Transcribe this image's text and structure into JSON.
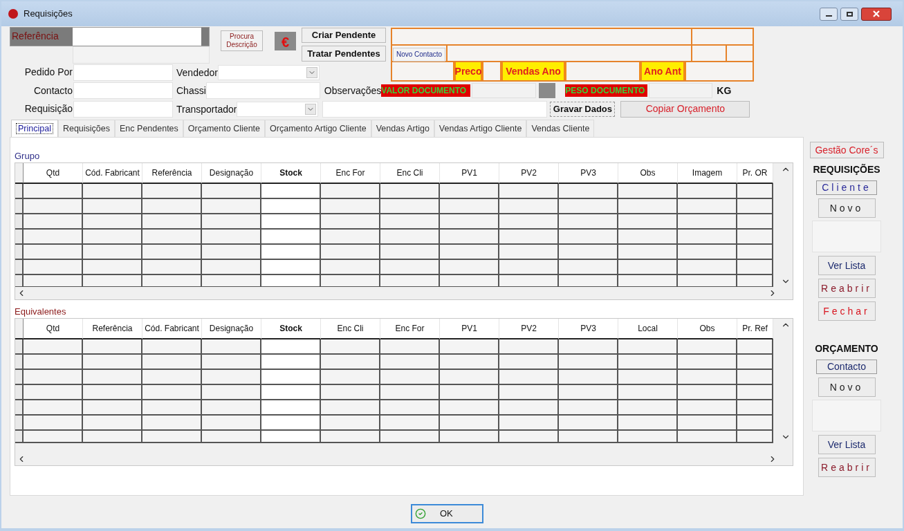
{
  "window": {
    "title": "Requisições"
  },
  "header": {
    "referencia_label": "Referência",
    "procura_button": "Procura Descrição",
    "currency_button": "€",
    "criar_button": "Criar Pendente",
    "tratar_button": "Tratar Pendentes"
  },
  "contact_panel": {
    "novo_contacto": "Novo Contacto",
    "preco": "Preco",
    "vendas_ano": "Vendas Ano",
    "ano_ant": "Ano Ant"
  },
  "fields": {
    "pedido_por": "Pedido Por",
    "vendedor": "Vendedor",
    "contacto": "Contacto",
    "chassi": "Chassi",
    "observacoes": "Observações",
    "requisicao": "Requisição",
    "transportador": "Transportador"
  },
  "totals": {
    "valor": "VALOR DOCUMENTO",
    "peso": "PESO DOCUMENTO",
    "unit": "KG"
  },
  "actions": {
    "gravar": "Gravar Dados",
    "copiar": "Copiar Orçamento"
  },
  "tabs": [
    {
      "label": "Principal",
      "selected": true
    },
    {
      "label": "Requisições",
      "selected": false
    },
    {
      "label": "Enc Pendentes",
      "selected": false
    },
    {
      "label": "Orçamento Cliente",
      "selected": false
    },
    {
      "label": "Orçamento Artigo Cliente",
      "selected": false
    },
    {
      "label": "Vendas Artigo",
      "selected": false
    },
    {
      "label": "Vendas Artigo Cliente",
      "selected": false
    },
    {
      "label": "Vendas Cliente",
      "selected": false
    }
  ],
  "grids": [
    {
      "title": "Grupo",
      "color": "#30308a",
      "columns": [
        {
          "label": "Qtd",
          "highlighted": false
        },
        {
          "label": "Cód. Fabricant",
          "highlighted": false
        },
        {
          "label": "Referência",
          "highlighted": false
        },
        {
          "label": "Designação",
          "highlighted": false
        },
        {
          "label": "Stock",
          "highlighted": true
        },
        {
          "label": "Enc For",
          "highlighted": false
        },
        {
          "label": "Enc Cli",
          "highlighted": false
        },
        {
          "label": "PV1",
          "highlighted": false
        },
        {
          "label": "PV2",
          "highlighted": false
        },
        {
          "label": "PV3",
          "highlighted": false
        },
        {
          "label": "Obs",
          "highlighted": false
        },
        {
          "label": "Imagem",
          "highlighted": false
        },
        {
          "label": "Pr. OR",
          "highlighted": false
        }
      ]
    },
    {
      "title": "Equivalentes",
      "color": "#8b1a1a",
      "columns": [
        {
          "label": "Qtd",
          "highlighted": false
        },
        {
          "label": "Referência",
          "highlighted": false
        },
        {
          "label": "Cód. Fabricant",
          "highlighted": false
        },
        {
          "label": "Designação",
          "highlighted": false
        },
        {
          "label": "Stock",
          "highlighted": true
        },
        {
          "label": "Enc Cli",
          "highlighted": false
        },
        {
          "label": "Enc For",
          "highlighted": false
        },
        {
          "label": "PV1",
          "highlighted": false
        },
        {
          "label": "PV2",
          "highlighted": false
        },
        {
          "label": "PV3",
          "highlighted": false
        },
        {
          "label": "Local",
          "highlighted": false
        },
        {
          "label": "Obs",
          "highlighted": false
        },
        {
          "label": "Pr. Ref",
          "highlighted": false
        }
      ]
    }
  ],
  "side": {
    "gestao_button": "Gestão Core´s",
    "sections": [
      {
        "title": "REQUISIÇÕES",
        "items": [
          {
            "kind": "button",
            "label": "Cliente",
            "color": "#2a2a9a",
            "spaced": true,
            "framed": true
          },
          {
            "kind": "button",
            "label": "Novo",
            "color": "#222222",
            "spaced": true,
            "framed": false
          },
          {
            "kind": "panel"
          },
          {
            "kind": "button",
            "label": "Ver Lista",
            "color": "#1c2a6e",
            "spaced": false,
            "framed": false
          },
          {
            "kind": "button",
            "label": "Reabrir",
            "color": "#8b1a2a",
            "spaced": true,
            "framed": false
          },
          {
            "kind": "button",
            "label": "Fechar",
            "color": "#d8141e",
            "spaced": true,
            "framed": false
          }
        ]
      },
      {
        "title": "ORÇAMENTO",
        "items": [
          {
            "kind": "button",
            "label": "Contacto",
            "color": "#1c2a6e",
            "spaced": false,
            "framed": true
          },
          {
            "kind": "button",
            "label": "Novo",
            "color": "#222222",
            "spaced": true,
            "framed": false
          },
          {
            "kind": "panel"
          },
          {
            "kind": "button",
            "label": "Ver Lista",
            "color": "#1c2a6e",
            "spaced": false,
            "framed": false
          },
          {
            "kind": "button",
            "label": "Reabrir",
            "color": "#8b1a2a",
            "spaced": true,
            "framed": false
          }
        ]
      }
    ]
  },
  "ok_button": "OK"
}
